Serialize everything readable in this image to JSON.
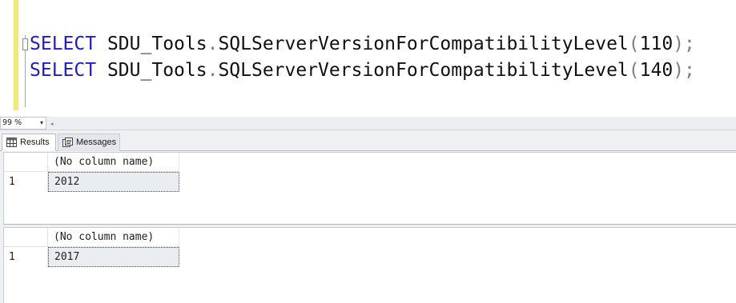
{
  "editor": {
    "lines": [
      {
        "keyword": "SELECT",
        "schema": "SDU_Tools",
        "dot": ".",
        "function": "SQLServerVersionForCompatibilityLevel",
        "open_paren": "(",
        "argument": "110",
        "close": ");"
      },
      {
        "keyword": "SELECT",
        "schema": "SDU_Tools",
        "dot": ".",
        "function": "SQLServerVersionForCompatibilityLevel",
        "open_paren": "(",
        "argument": "140",
        "close": ");"
      }
    ]
  },
  "zoom": {
    "value": "99 %",
    "arrow_icon": "▾"
  },
  "tabs": [
    {
      "label": "Results",
      "icon": "grid-icon",
      "active": true
    },
    {
      "label": "Messages",
      "icon": "messages-icon",
      "active": false
    }
  ],
  "grids": [
    {
      "column_header": "(No column name)",
      "rows": [
        {
          "row_number": "1",
          "value": "2012"
        }
      ]
    },
    {
      "column_header": "(No column name)",
      "rows": [
        {
          "row_number": "1",
          "value": "2017"
        }
      ]
    }
  ],
  "colors": {
    "keyword": "#1b1bd6",
    "operator": "#808080",
    "margin_bar": "#f5e96e",
    "panel_bg": "#eef0f4"
  }
}
